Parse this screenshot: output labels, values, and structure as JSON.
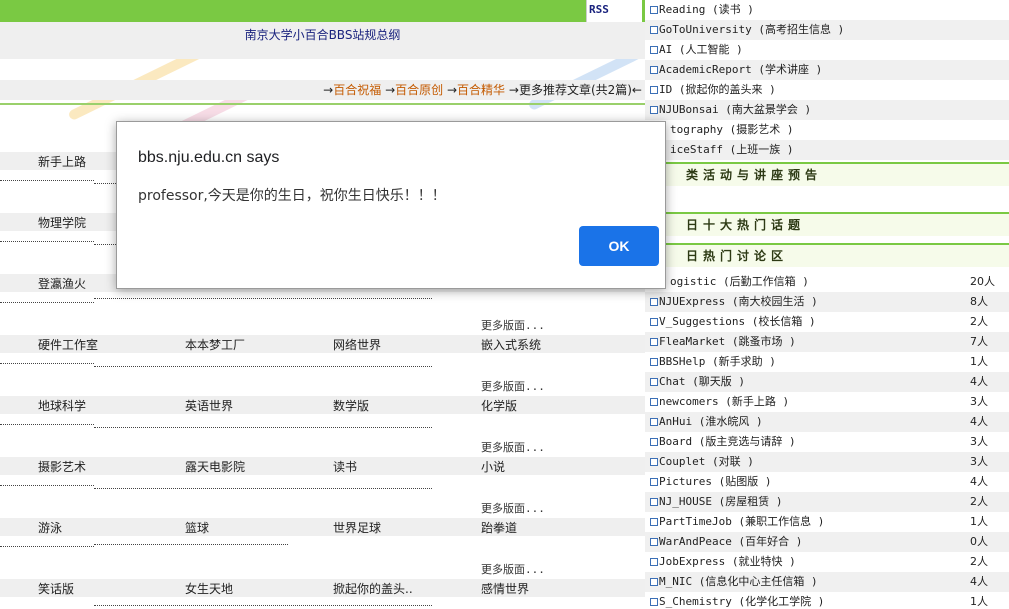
{
  "header": {
    "rss_label": "RSS",
    "rules_title": "南京大学小百合BBS站规总纲"
  },
  "nav": {
    "arrow": "→",
    "links": [
      "百合祝福",
      "百合原创",
      "百合精华"
    ],
    "more_text": "更多推荐文章(共2篇)←"
  },
  "board_rows": [
    {
      "cells": [
        "新手上路",
        "",
        "",
        ""
      ],
      "more": ""
    },
    {
      "cells": [
        "物理学院",
        "",
        "",
        ""
      ],
      "more": ""
    },
    {
      "cells": [
        "登瀛渔火",
        "",
        "",
        ""
      ],
      "more": ""
    },
    {
      "cells": [
        "硬件工作室",
        "本本梦工厂",
        "网络世界",
        "嵌入式系统"
      ],
      "more": "更多版面..."
    },
    {
      "cells": [
        "地球科学",
        "英语世界",
        "数学版",
        "化学版"
      ],
      "more": "更多版面..."
    },
    {
      "cells": [
        "摄影艺术",
        "露天电影院",
        "读书",
        "小说"
      ],
      "more": "更多版面..."
    },
    {
      "cells": [
        "游泳",
        "篮球",
        "世界足球",
        "跆拳道"
      ],
      "more": "更多版面..."
    },
    {
      "cells": [
        "笑话版",
        "女生天地",
        "掀起你的盖头..",
        "感情世界"
      ],
      "more": "更多版面..."
    }
  ],
  "right_top": [
    {
      "text": "Reading (读书 )"
    },
    {
      "text": "GoToUniversity (高考招生信息 )"
    },
    {
      "text": "AI (人工智能 )"
    },
    {
      "text": "AcademicReport (学术讲座 )"
    },
    {
      "text": "ID (掀起你的盖头来 )"
    },
    {
      "text": "NJUBonsai (南大盆景学会 )"
    },
    {
      "text": "tography (摄影艺术 )"
    },
    {
      "text": "iceStaff (上班一族 )"
    }
  ],
  "sections": [
    "类活动与讲座预告",
    "日十大热门话题",
    "日热门讨论区"
  ],
  "hot_boards": [
    {
      "text": "ogistic (后勤工作信箱 )",
      "count": "20人"
    },
    {
      "text": "NJUExpress (南大校园生活 )",
      "count": "8人"
    },
    {
      "text": "V_Suggestions (校长信箱 )",
      "count": "2人"
    },
    {
      "text": "FleaMarket (跳蚤市场 )",
      "count": "7人"
    },
    {
      "text": "BBSHelp (新手求助 )",
      "count": "1人"
    },
    {
      "text": "Chat (聊天版 )",
      "count": "4人"
    },
    {
      "text": "newcomers (新手上路 )",
      "count": "3人"
    },
    {
      "text": "AnHui (淮水皖风 )",
      "count": "4人"
    },
    {
      "text": "Board (版主竞选与请辞 )",
      "count": "3人"
    },
    {
      "text": "Couplet (对联 )",
      "count": "3人"
    },
    {
      "text": "Pictures (贴图版 )",
      "count": "4人"
    },
    {
      "text": "NJ_HOUSE (房屋租赁 )",
      "count": "2人"
    },
    {
      "text": "PartTimeJob (兼职工作信息 )",
      "count": "1人"
    },
    {
      "text": "WarAndPeace (百年好合 )",
      "count": "0人"
    },
    {
      "text": "JobExpress (就业特快 )",
      "count": "2人"
    },
    {
      "text": "M_NIC (信息化中心主任信箱 )",
      "count": "4人"
    },
    {
      "text": "S_Chemistry (化学化工学院 )",
      "count": "1人"
    }
  ],
  "dialog": {
    "title": "bbs.nju.edu.cn says",
    "message": "professor,今天是你的生日，祝你生日快乐！！！",
    "ok_label": "OK"
  },
  "colors": {
    "accent_green": "#7ac943",
    "dialog_button": "#1a73e8",
    "title_blue": "#1a237e"
  }
}
